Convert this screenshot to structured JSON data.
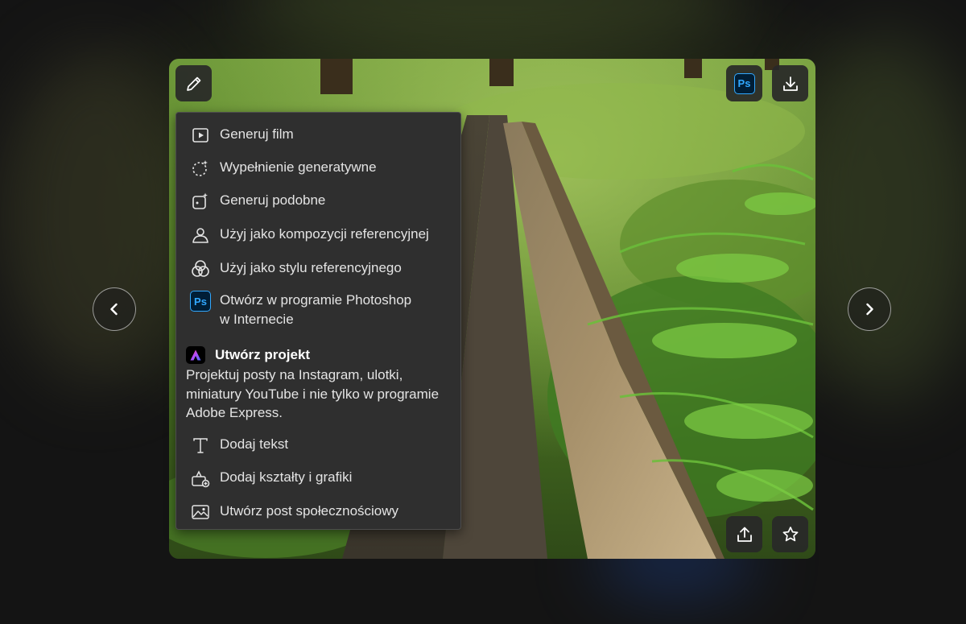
{
  "navigation": {
    "prev_icon": "chevron-left-icon",
    "next_icon": "chevron-right-icon"
  },
  "toolbar": {
    "edit_icon": "pencil-icon",
    "photoshop_badge": "Ps",
    "download_icon": "download-icon",
    "share_icon": "share-icon",
    "favorite_icon": "star-icon"
  },
  "menu": {
    "items": [
      {
        "label": "Generuj film",
        "icon": "video-play-icon"
      },
      {
        "label": "Wypełnienie generatywne",
        "icon": "generative-fill-icon"
      },
      {
        "label": "Generuj podobne",
        "icon": "generate-similar-icon"
      },
      {
        "label": "Użyj jako kompozycji referencyjnej",
        "icon": "composition-reference-icon"
      },
      {
        "label": "Użyj jako stylu referencyjnego",
        "icon": "style-reference-icon"
      },
      {
        "label": "Otwórz w programie Photoshop",
        "label_line2": "w Internecie",
        "icon": "photoshop-icon",
        "badge": "Ps"
      }
    ],
    "express": {
      "title": "Utwórz projekt",
      "description": "Projektuj posty na Instagram, ulotki, miniatury YouTube i nie tylko w programie Adobe Express.",
      "icon": "adobe-express-icon"
    },
    "secondary_items": [
      {
        "label": "Dodaj tekst",
        "icon": "text-icon"
      },
      {
        "label": "Dodaj kształty i grafiki",
        "icon": "shapes-icon"
      },
      {
        "label": "Utwórz post społecznościowy",
        "icon": "image-post-icon"
      }
    ]
  },
  "colors": {
    "menu_background": "#2f2f2f",
    "menu_text": "#e4e4e4",
    "photoshop_blue": "#31a8ff",
    "button_background": "#282828"
  }
}
